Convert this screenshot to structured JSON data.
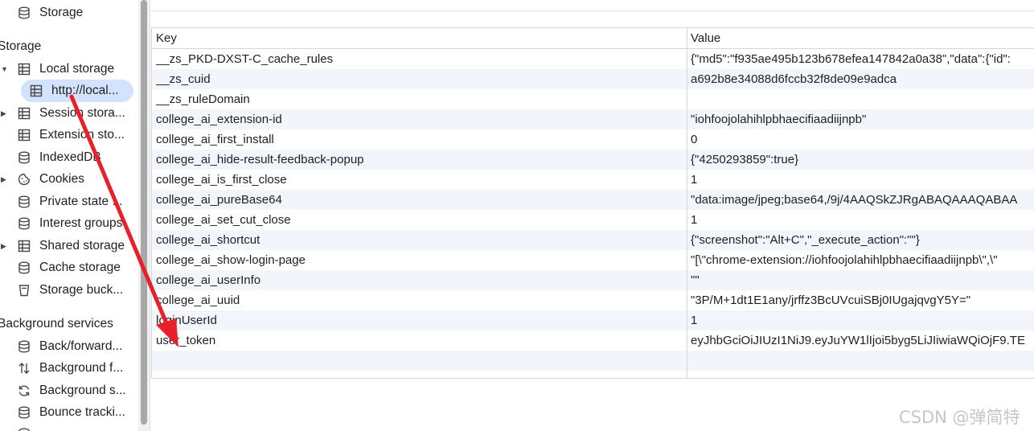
{
  "sidebar": {
    "top_item": "Storage",
    "storage_section": "Storage",
    "local_storage": "Local storage",
    "local_storage_child": "http://local...",
    "session_storage": "Session stora...",
    "extension_storage": "Extension sto...",
    "indexeddb": "IndexedDB",
    "cookies": "Cookies",
    "private_state": "Private state ...",
    "interest_groups": "Interest groups",
    "shared_storage": "Shared storage",
    "cache_storage": "Cache storage",
    "storage_buckets": "Storage buck...",
    "background_section": "Background services",
    "back_forward": "Back/forward...",
    "background_fetch": "Background f...",
    "background_sync": "Background s...",
    "bounce_tracking": "Bounce tracki..."
  },
  "table": {
    "headers": {
      "key": "Key",
      "value": "Value"
    },
    "rows": [
      {
        "key": "__zs_PKD-DXST-C_cache_rules",
        "value": "{\"md5\":\"f935ae495b123b678efea147842a0a38\",\"data\":{\"id\":"
      },
      {
        "key": "__zs_cuid",
        "value": "a692b8e34088d6fccb32f8de09e9adca"
      },
      {
        "key": "__zs_ruleDomain",
        "value": ""
      },
      {
        "key": "college_ai_extension-id",
        "value": "\"iohfoojolahihlpbhaecifiaadiijnpb\""
      },
      {
        "key": "college_ai_first_install",
        "value": "0"
      },
      {
        "key": "college_ai_hide-result-feedback-popup",
        "value": "{\"4250293859\":true}"
      },
      {
        "key": "college_ai_is_first_close",
        "value": "1"
      },
      {
        "key": "college_ai_pureBase64",
        "value": "\"data:image/jpeg;base64,/9j/4AAQSkZJRgABAQAAAQABAA"
      },
      {
        "key": "college_ai_set_cut_close",
        "value": "1"
      },
      {
        "key": "college_ai_shortcut",
        "value": "{\"screenshot\":\"Alt+C\",\"_execute_action\":\"\"}"
      },
      {
        "key": "college_ai_show-login-page",
        "value": "\"[\\\"chrome-extension://iohfoojolahihlpbhaecifiaadiijnpb\\\",\\\""
      },
      {
        "key": "college_ai_userInfo",
        "value": "\"\""
      },
      {
        "key": "college_ai_uuid",
        "value": "\"3P/M+1dt1E1any/jrffz3BcUVcuiSBj0IUgajqvgY5Y=\""
      },
      {
        "key": "loginUserId",
        "value": "1"
      },
      {
        "key": "user_token",
        "value": "eyJhbGciOiJIUzI1NiJ9.eyJuYW1lIjoi5byg5LiJIiwiaWQiOjF9.TE"
      },
      {
        "key": "",
        "value": ""
      }
    ]
  },
  "watermark": "CSDN @弹简特",
  "colors": {
    "annotation_arrow": "#e8202a",
    "selection": "#d3e3fd",
    "alt_row": "#f2f5fa"
  }
}
